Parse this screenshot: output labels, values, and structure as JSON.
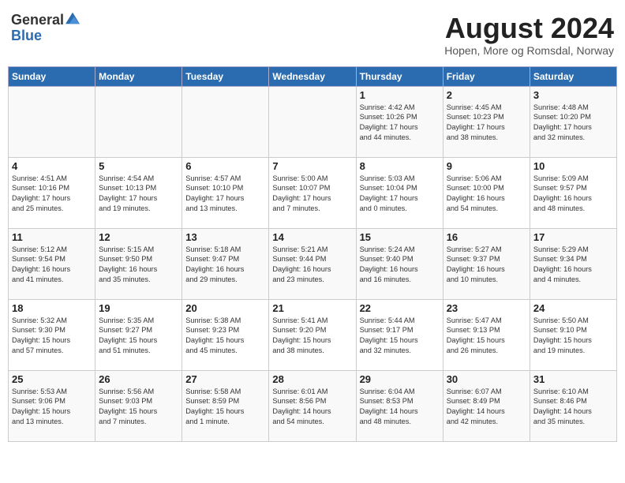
{
  "logo": {
    "general": "General",
    "blue": "Blue"
  },
  "title": "August 2024",
  "subtitle": "Hopen, More og Romsdal, Norway",
  "days_header": [
    "Sunday",
    "Monday",
    "Tuesday",
    "Wednesday",
    "Thursday",
    "Friday",
    "Saturday"
  ],
  "weeks": [
    [
      {
        "day": "",
        "content": ""
      },
      {
        "day": "",
        "content": ""
      },
      {
        "day": "",
        "content": ""
      },
      {
        "day": "",
        "content": ""
      },
      {
        "day": "1",
        "content": "Sunrise: 4:42 AM\nSunset: 10:26 PM\nDaylight: 17 hours\nand 44 minutes."
      },
      {
        "day": "2",
        "content": "Sunrise: 4:45 AM\nSunset: 10:23 PM\nDaylight: 17 hours\nand 38 minutes."
      },
      {
        "day": "3",
        "content": "Sunrise: 4:48 AM\nSunset: 10:20 PM\nDaylight: 17 hours\nand 32 minutes."
      }
    ],
    [
      {
        "day": "4",
        "content": "Sunrise: 4:51 AM\nSunset: 10:16 PM\nDaylight: 17 hours\nand 25 minutes."
      },
      {
        "day": "5",
        "content": "Sunrise: 4:54 AM\nSunset: 10:13 PM\nDaylight: 17 hours\nand 19 minutes."
      },
      {
        "day": "6",
        "content": "Sunrise: 4:57 AM\nSunset: 10:10 PM\nDaylight: 17 hours\nand 13 minutes."
      },
      {
        "day": "7",
        "content": "Sunrise: 5:00 AM\nSunset: 10:07 PM\nDaylight: 17 hours\nand 7 minutes."
      },
      {
        "day": "8",
        "content": "Sunrise: 5:03 AM\nSunset: 10:04 PM\nDaylight: 17 hours\nand 0 minutes."
      },
      {
        "day": "9",
        "content": "Sunrise: 5:06 AM\nSunset: 10:00 PM\nDaylight: 16 hours\nand 54 minutes."
      },
      {
        "day": "10",
        "content": "Sunrise: 5:09 AM\nSunset: 9:57 PM\nDaylight: 16 hours\nand 48 minutes."
      }
    ],
    [
      {
        "day": "11",
        "content": "Sunrise: 5:12 AM\nSunset: 9:54 PM\nDaylight: 16 hours\nand 41 minutes."
      },
      {
        "day": "12",
        "content": "Sunrise: 5:15 AM\nSunset: 9:50 PM\nDaylight: 16 hours\nand 35 minutes."
      },
      {
        "day": "13",
        "content": "Sunrise: 5:18 AM\nSunset: 9:47 PM\nDaylight: 16 hours\nand 29 minutes."
      },
      {
        "day": "14",
        "content": "Sunrise: 5:21 AM\nSunset: 9:44 PM\nDaylight: 16 hours\nand 23 minutes."
      },
      {
        "day": "15",
        "content": "Sunrise: 5:24 AM\nSunset: 9:40 PM\nDaylight: 16 hours\nand 16 minutes."
      },
      {
        "day": "16",
        "content": "Sunrise: 5:27 AM\nSunset: 9:37 PM\nDaylight: 16 hours\nand 10 minutes."
      },
      {
        "day": "17",
        "content": "Sunrise: 5:29 AM\nSunset: 9:34 PM\nDaylight: 16 hours\nand 4 minutes."
      }
    ],
    [
      {
        "day": "18",
        "content": "Sunrise: 5:32 AM\nSunset: 9:30 PM\nDaylight: 15 hours\nand 57 minutes."
      },
      {
        "day": "19",
        "content": "Sunrise: 5:35 AM\nSunset: 9:27 PM\nDaylight: 15 hours\nand 51 minutes."
      },
      {
        "day": "20",
        "content": "Sunrise: 5:38 AM\nSunset: 9:23 PM\nDaylight: 15 hours\nand 45 minutes."
      },
      {
        "day": "21",
        "content": "Sunrise: 5:41 AM\nSunset: 9:20 PM\nDaylight: 15 hours\nand 38 minutes."
      },
      {
        "day": "22",
        "content": "Sunrise: 5:44 AM\nSunset: 9:17 PM\nDaylight: 15 hours\nand 32 minutes."
      },
      {
        "day": "23",
        "content": "Sunrise: 5:47 AM\nSunset: 9:13 PM\nDaylight: 15 hours\nand 26 minutes."
      },
      {
        "day": "24",
        "content": "Sunrise: 5:50 AM\nSunset: 9:10 PM\nDaylight: 15 hours\nand 19 minutes."
      }
    ],
    [
      {
        "day": "25",
        "content": "Sunrise: 5:53 AM\nSunset: 9:06 PM\nDaylight: 15 hours\nand 13 minutes."
      },
      {
        "day": "26",
        "content": "Sunrise: 5:56 AM\nSunset: 9:03 PM\nDaylight: 15 hours\nand 7 minutes."
      },
      {
        "day": "27",
        "content": "Sunrise: 5:58 AM\nSunset: 8:59 PM\nDaylight: 15 hours\nand 1 minute."
      },
      {
        "day": "28",
        "content": "Sunrise: 6:01 AM\nSunset: 8:56 PM\nDaylight: 14 hours\nand 54 minutes."
      },
      {
        "day": "29",
        "content": "Sunrise: 6:04 AM\nSunset: 8:53 PM\nDaylight: 14 hours\nand 48 minutes."
      },
      {
        "day": "30",
        "content": "Sunrise: 6:07 AM\nSunset: 8:49 PM\nDaylight: 14 hours\nand 42 minutes."
      },
      {
        "day": "31",
        "content": "Sunrise: 6:10 AM\nSunset: 8:46 PM\nDaylight: 14 hours\nand 35 minutes."
      }
    ]
  ]
}
